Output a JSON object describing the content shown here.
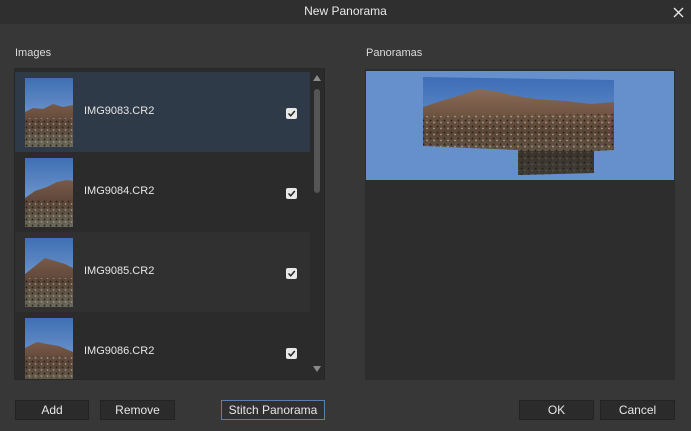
{
  "window": {
    "title": "New Panorama",
    "close_icon": "close-icon"
  },
  "images_section": {
    "label": "Images",
    "items": [
      {
        "name": "IMG9083.CR2",
        "checked": true,
        "selected": true
      },
      {
        "name": "IMG9084.CR2",
        "checked": true,
        "selected": false
      },
      {
        "name": "IMG9085.CR2",
        "checked": true,
        "selected": false
      },
      {
        "name": "IMG9086.CR2",
        "checked": true,
        "selected": false
      }
    ]
  },
  "panoramas_section": {
    "label": "Panoramas"
  },
  "buttons": {
    "add": "Add",
    "remove": "Remove",
    "stitch": "Stitch Panorama",
    "ok": "OK",
    "cancel": "Cancel"
  },
  "colors": {
    "background": "#373737",
    "selected_row": "#2e3a47",
    "panorama_sky": "#6590cc",
    "primary_border": "#5b7fad"
  }
}
